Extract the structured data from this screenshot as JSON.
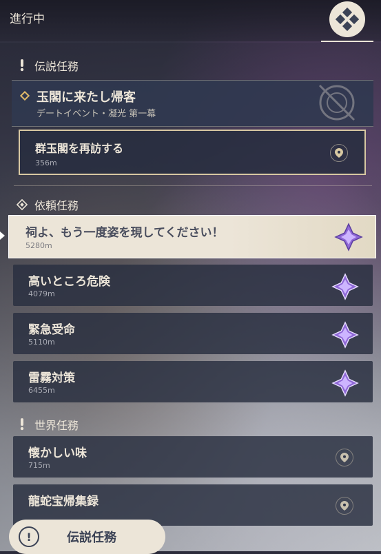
{
  "header": {
    "title": "進行中",
    "icon": "quest-menu-icon"
  },
  "sections": {
    "legend": {
      "title": "伝説任務",
      "icon": "exclamation-icon"
    },
    "commission": {
      "title": "依頼任務",
      "icon": "diamond-icon"
    },
    "world": {
      "title": "世界任務",
      "icon": "exclamation-icon"
    }
  },
  "legend_quest": {
    "title": "玉閣に来たし帰客",
    "subtitle": "デートイベント・凝光 第一幕",
    "step": {
      "title": "群玉閣を再訪する",
      "distance": "356m"
    }
  },
  "commissions": [
    {
      "title": "祠よ、もう一度姿を現してください！",
      "distance": "5280m"
    },
    {
      "title": "高いところ危険",
      "distance": "4079m"
    },
    {
      "title": "緊急受命",
      "distance": "5110m"
    },
    {
      "title": "雷霧対策",
      "distance": "6455m"
    }
  ],
  "world_quests": [
    {
      "title": "懐かしい味",
      "distance": "715m"
    },
    {
      "title": "龍蛇宝帰集録",
      "distance": ""
    }
  ],
  "bottom_button": {
    "label": "伝説任務",
    "icon": "exclamation-icon"
  },
  "colors": {
    "accent": "#ece5d8",
    "commission_star": "#b48cf0",
    "card_bg": "#2e3448"
  }
}
